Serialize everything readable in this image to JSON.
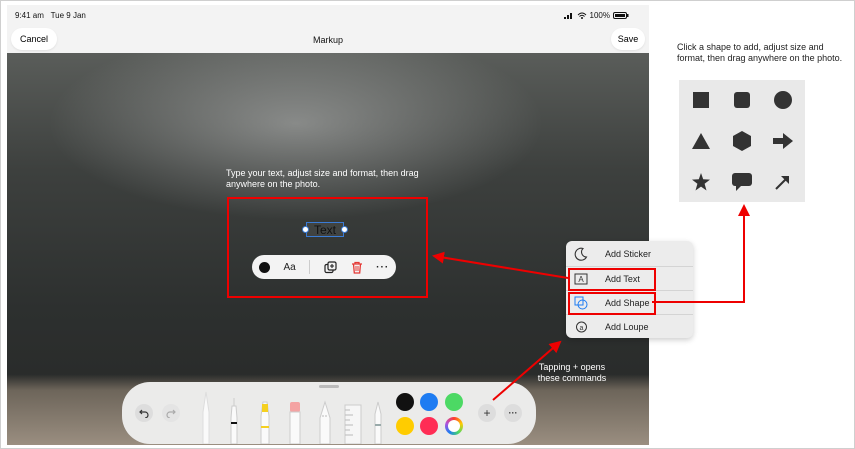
{
  "status": {
    "time": "9:41 am",
    "date": "Tue 9 Jan",
    "battery": "100%"
  },
  "nav": {
    "cancel": "Cancel",
    "title": "Markup",
    "save": "Save"
  },
  "annotations": {
    "text_instruction": "Type your text, adjust size and format, then drag anywhere on the photo.",
    "plus_hint": "Tapping + opens these commands",
    "shape_instruction": "Click a shape to add, adjust size and format, then drag anywhere on the photo."
  },
  "text_object": {
    "value": "Text"
  },
  "text_toolbar": {
    "font_label": "Aa"
  },
  "menu": {
    "items": [
      {
        "label": "Add Sticker",
        "icon": "sticker-icon"
      },
      {
        "label": "Add Text",
        "icon": "text-box-icon"
      },
      {
        "label": "Add Shape",
        "icon": "shapes-icon"
      },
      {
        "label": "Add Loupe",
        "icon": "loupe-icon"
      }
    ]
  },
  "palette": {
    "colors": [
      "#111111",
      "#1e7cf2",
      "#4cd964",
      "#ffcc00",
      "#ff2d55",
      "multicolor"
    ]
  },
  "shapes": [
    "square",
    "rounded-square",
    "circle",
    "triangle",
    "hexagon",
    "arrow-right",
    "star",
    "speech-bubble",
    "arrow-diagonal"
  ],
  "accent": {
    "annotation_red": "#e00000",
    "selection_blue": "#3a7bd5"
  }
}
